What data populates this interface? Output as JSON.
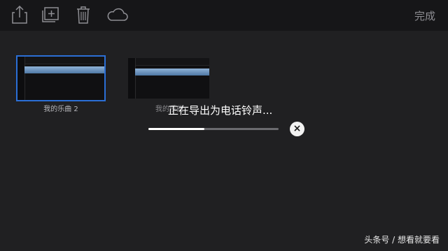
{
  "toolbar": {
    "icons": [
      "share-icon",
      "add-icon",
      "trash-icon",
      "cloud-icon"
    ],
    "done_label": "完成"
  },
  "songs": [
    {
      "label": "我的乐曲 2",
      "selected": true
    },
    {
      "label": "我的乐曲",
      "selected": false
    }
  ],
  "export_dialog": {
    "message": "正在导出为电话铃声...",
    "progress": 0.43,
    "cancel_glyph": "×"
  },
  "watermark": "头条号 / 想看就要看",
  "colors": {
    "background": "#202022",
    "toolbar": "#161618",
    "selection": "#2b6fd6",
    "track": "#6d94c0"
  }
}
